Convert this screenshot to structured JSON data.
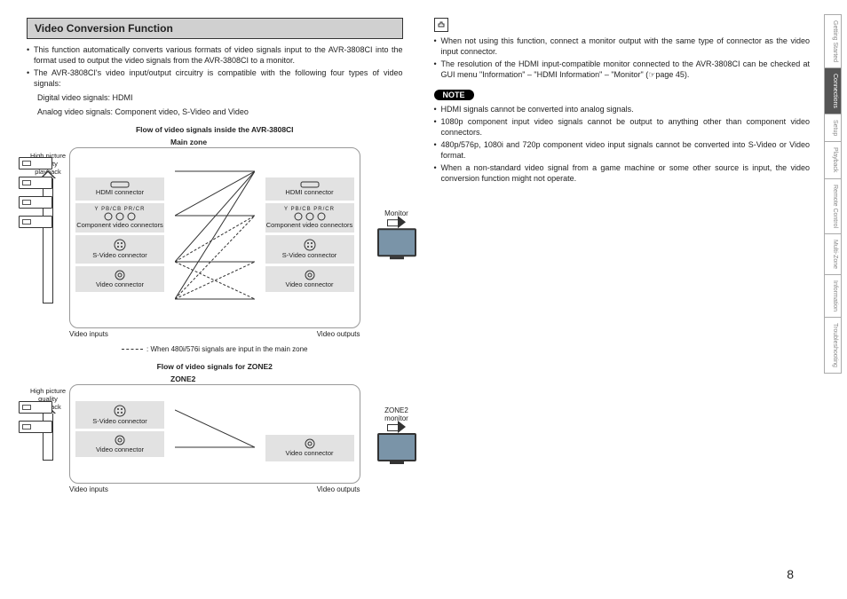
{
  "title": "Video Conversion Function",
  "bullets_intro": [
    "This function automatically converts various formats of video signals input to the AVR-3808CI into the format used to output the video signals from the AVR-3808CI to a monitor.",
    "The AVR-3808CI's video input/output circuitry is compatible with the following four types of video signals:"
  ],
  "signal_types": {
    "digital": "Digital video signals: HDMI",
    "analog": "Analog video signals: Component video, S-Video and Video"
  },
  "diagram1": {
    "title": "Flow of video signals inside the AVR-3808CI",
    "zone": "Main zone",
    "quality": "High picture quality playback",
    "inputs_label": "Video inputs",
    "outputs_label": "Video outputs",
    "monitor_label": "Monitor",
    "nodes": {
      "hdmi": "HDMI connector",
      "component": "Component video connectors",
      "svideo": "S-Video connector",
      "video": "Video connector",
      "comp_labels": "Y   PB/CB  PR/CR"
    },
    "legend": "When 480i/576i signals are input in the main zone"
  },
  "diagram2": {
    "title": "Flow of video signals for ZONE2",
    "zone": "ZONE2",
    "quality": "High picture quality playback",
    "inputs_label": "Video inputs",
    "outputs_label": "Video outputs",
    "monitor_label": "ZONE2 monitor"
  },
  "bullets_right_top": [
    "When not using this function, connect a monitor output with the same type of connector as the video input connector.",
    "The resolution of the HDMI input-compatible monitor connected to the AVR-3808CI can be checked at GUI menu \"Information\" – \"HDMI Information\" – \"Monitor\" (☞page 45)."
  ],
  "note_label": "NOTE",
  "bullets_note": [
    "HDMI signals cannot be converted into analog signals.",
    "1080p component input video signals cannot be output to anything other than component video connectors.",
    "480p/576p, 1080i and 720p component video input signals cannot be converted into S-Video or Video format.",
    "When a non-standard video signal from a game machine or some other source is input, the video conversion function might not operate."
  ],
  "page_number": "8",
  "side_tabs": [
    "Getting Started",
    "Connections",
    "Setup",
    "Playback",
    "Remote Control",
    "Multi-Zone",
    "Information",
    "Troubleshooting"
  ],
  "active_tab_index": 1
}
